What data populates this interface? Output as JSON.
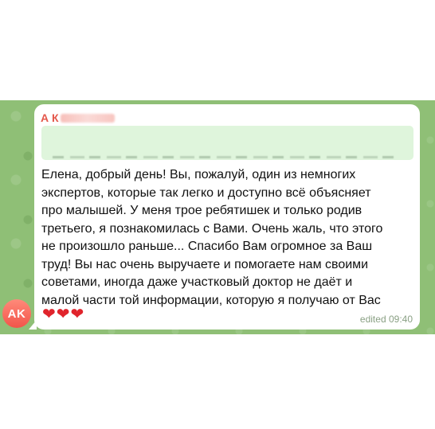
{
  "chat": {
    "avatar_initials": "AK",
    "message": {
      "sender_visible_initial": "А К",
      "text": "Елена, добрый день! Вы, пожалуй, один из немногих\nэкспертов, которые так легко и доступно всё объясняет\nпро малышей. У меня трое ребятишек и только родив\nтретьего, я познакомилась с Вами. Очень жаль, что этого\nне произошло раньше... Спасибо Вам огромное за Ваш\nтруд! Вы нас очень выручаете и помогаете нам своими\nсоветами, иногда даже участковый доктор не даёт и\nмалой части той информации, которую я получаю от Вас",
      "emoji": "❤❤❤",
      "edited_label": "edited",
      "time": "09:40"
    }
  },
  "colors": {
    "background_green": "#8fbf76",
    "sender_name": "#e4574b",
    "reply_box": "#dff5dc",
    "avatar": "#f2554a",
    "hearts": "#e0242c"
  }
}
